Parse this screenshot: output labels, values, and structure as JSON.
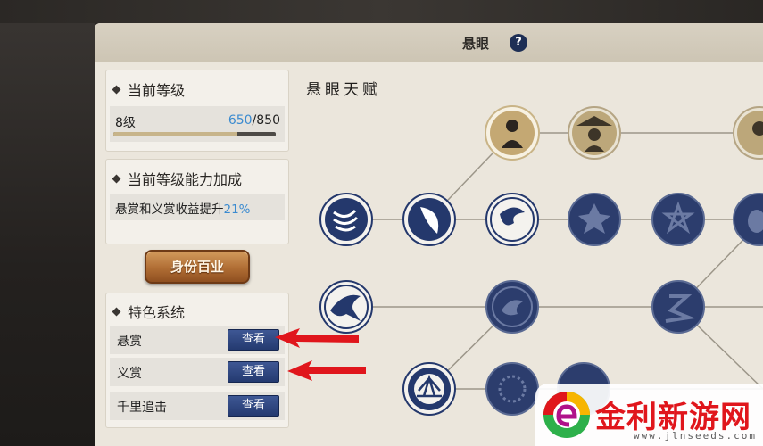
{
  "window": {
    "title": "悬眼",
    "help_icon": "?"
  },
  "current_level": {
    "heading": "当前等级",
    "level_label": "8级",
    "exp_current": "650",
    "exp_max": "/850",
    "progress_fraction": 0.765
  },
  "ability_bonus": {
    "heading": "当前等级能力加成",
    "text": "悬赏和义赏收益提升",
    "percent": "21%"
  },
  "identity_button": {
    "label": "身份百业"
  },
  "features": {
    "heading": "特色系统",
    "rows": [
      {
        "label": "悬赏",
        "button": "查看"
      },
      {
        "label": "义赏",
        "button": "查看"
      },
      {
        "label": "千里追击",
        "button": "查看"
      }
    ]
  },
  "talent": {
    "heading": "悬眼天赋",
    "nodes": [
      {
        "icon": "swordsman-portrait-icon",
        "style": "gold-selected"
      },
      {
        "icon": "straw-hat-portrait-icon",
        "style": "gold"
      },
      {
        "icon": "hatted-figure-portrait-icon",
        "style": "gold"
      },
      {
        "icon": "claw-slash-icon",
        "style": "blue"
      },
      {
        "icon": "hooded-face-icon",
        "style": "blue"
      },
      {
        "icon": "swirling-wind-icon",
        "style": "blue"
      },
      {
        "icon": "flower-burst-icon",
        "style": "dark"
      },
      {
        "icon": "star-mark-icon",
        "style": "dark"
      },
      {
        "icon": "mask-icon",
        "style": "dark"
      },
      {
        "icon": "flying-bird-icon",
        "style": "blue"
      },
      {
        "icon": "bird-emblem-icon",
        "style": "dark"
      },
      {
        "icon": "script-glyph-icon",
        "style": "dark"
      },
      {
        "icon": "radiant-fan-icon",
        "style": "blue"
      },
      {
        "icon": "orb-pattern-icon",
        "style": "dark"
      },
      {
        "icon": "partial-emblem-icon",
        "style": "dark"
      }
    ]
  },
  "colors": {
    "panel_bg": "#ebe6dc",
    "node_blue": "#24386c",
    "node_gold": "#c9b487",
    "highlight_blue": "#3b8bd0",
    "arrow_red": "#e0161c"
  },
  "watermark": {
    "text": "金利新游网",
    "url": "www.jlnseeds.com"
  }
}
